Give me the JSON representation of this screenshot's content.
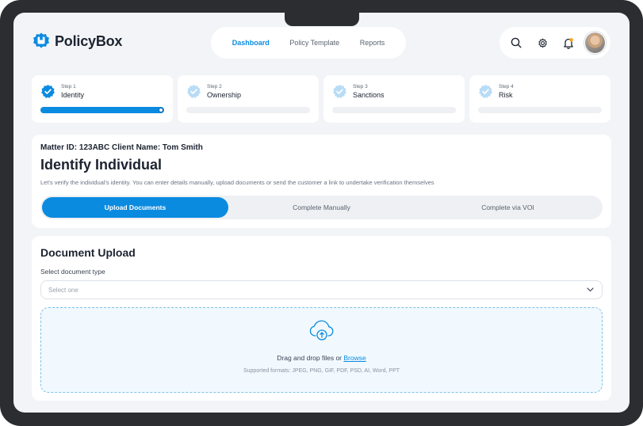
{
  "brand": {
    "name": "PolicyBox",
    "accent": "#0b8be0"
  },
  "nav": {
    "items": [
      {
        "label": "Dashboard",
        "active": true
      },
      {
        "label": "Policy Template",
        "active": false
      },
      {
        "label": "Reports",
        "active": false
      }
    ]
  },
  "header_icons": [
    "search-icon",
    "gear-icon",
    "bell-icon",
    "avatar"
  ],
  "steps": [
    {
      "number": "Step 1",
      "name": "Identity",
      "complete": true,
      "progress": 1.0
    },
    {
      "number": "Step 2",
      "name": "Ownership",
      "complete": false,
      "progress": 0
    },
    {
      "number": "Step 3",
      "name": "Sanctions",
      "complete": false,
      "progress": 0
    },
    {
      "number": "Step 4",
      "name": "Risk",
      "complete": false,
      "progress": 0
    }
  ],
  "identity": {
    "matter": "Matter ID: 123ABC Client Name: Tom Smith",
    "title": "Identify Individual",
    "description": "Let's verify the individual's identity. You can enter details manually, upload documents or send the customer a link to undertake verification themselves",
    "tabs": [
      {
        "label": "Upload Documents",
        "active": true
      },
      {
        "label": "Complete Manually",
        "active": false
      },
      {
        "label": "Complete via VOI",
        "active": false
      }
    ]
  },
  "upload": {
    "title": "Document Upload",
    "select_label": "Select document type",
    "select_placeholder": "Select one",
    "drop_text": "Drag and drop files or",
    "browse_label": "Browse",
    "formats": "Supported formats: JPEG, PNG, GIF, PDF, PSD, AI, Word, PPT"
  }
}
